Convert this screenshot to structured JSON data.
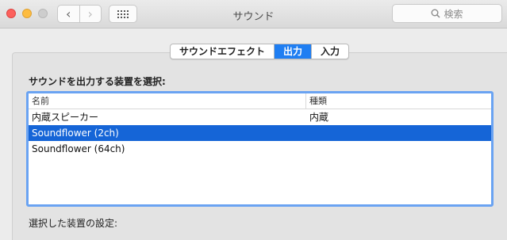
{
  "window": {
    "title": "サウンド"
  },
  "toolbar": {
    "back_glyph": "‹",
    "forward_glyph": "›",
    "grid_icon": "grid-icon",
    "search_placeholder": "検索"
  },
  "tabs": [
    {
      "label": "サウンドエフェクト",
      "active": false
    },
    {
      "label": "出力",
      "active": true
    },
    {
      "label": "入力",
      "active": false
    }
  ],
  "output": {
    "select_label": "サウンドを出力する装置を選択:",
    "columns": {
      "name": "名前",
      "type": "種類"
    },
    "rows": [
      {
        "name": "内蔵スピーカー",
        "type": "内蔵",
        "selected": false
      },
      {
        "name": "Soundflower (2ch)",
        "type": "",
        "selected": true
      },
      {
        "name": "Soundflower (64ch)",
        "type": "",
        "selected": false
      }
    ],
    "settings_label": "選択した装置の設定:"
  },
  "colors": {
    "accent": "#1565d7",
    "tab_active": "#1f7ef2",
    "focus_ring": "#6aa3f2"
  }
}
